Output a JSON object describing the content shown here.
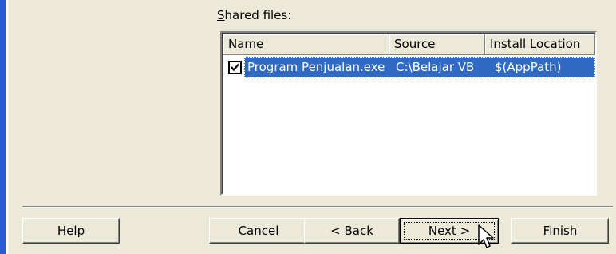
{
  "shared_files": {
    "label_accel": "S",
    "label_rest": "hared files:"
  },
  "listview": {
    "columns": [
      "Name",
      "Source",
      "Install Location"
    ],
    "rows": [
      {
        "checked": true,
        "name": "Program Penjualan.exe",
        "source": "C:\\Belajar VB",
        "install_location": "$(AppPath)"
      }
    ]
  },
  "buttons": {
    "help": "Help",
    "cancel": "Cancel",
    "back_prefix": "< ",
    "back_accel": "B",
    "back_rest": "ack",
    "next_accel": "N",
    "next_rest": "ext >",
    "finish_accel": "F",
    "finish_rest": "inish"
  },
  "colors": {
    "selection": "#316ac5",
    "window_bg": "#ece9d8",
    "side_accent": "#2b59d2"
  }
}
